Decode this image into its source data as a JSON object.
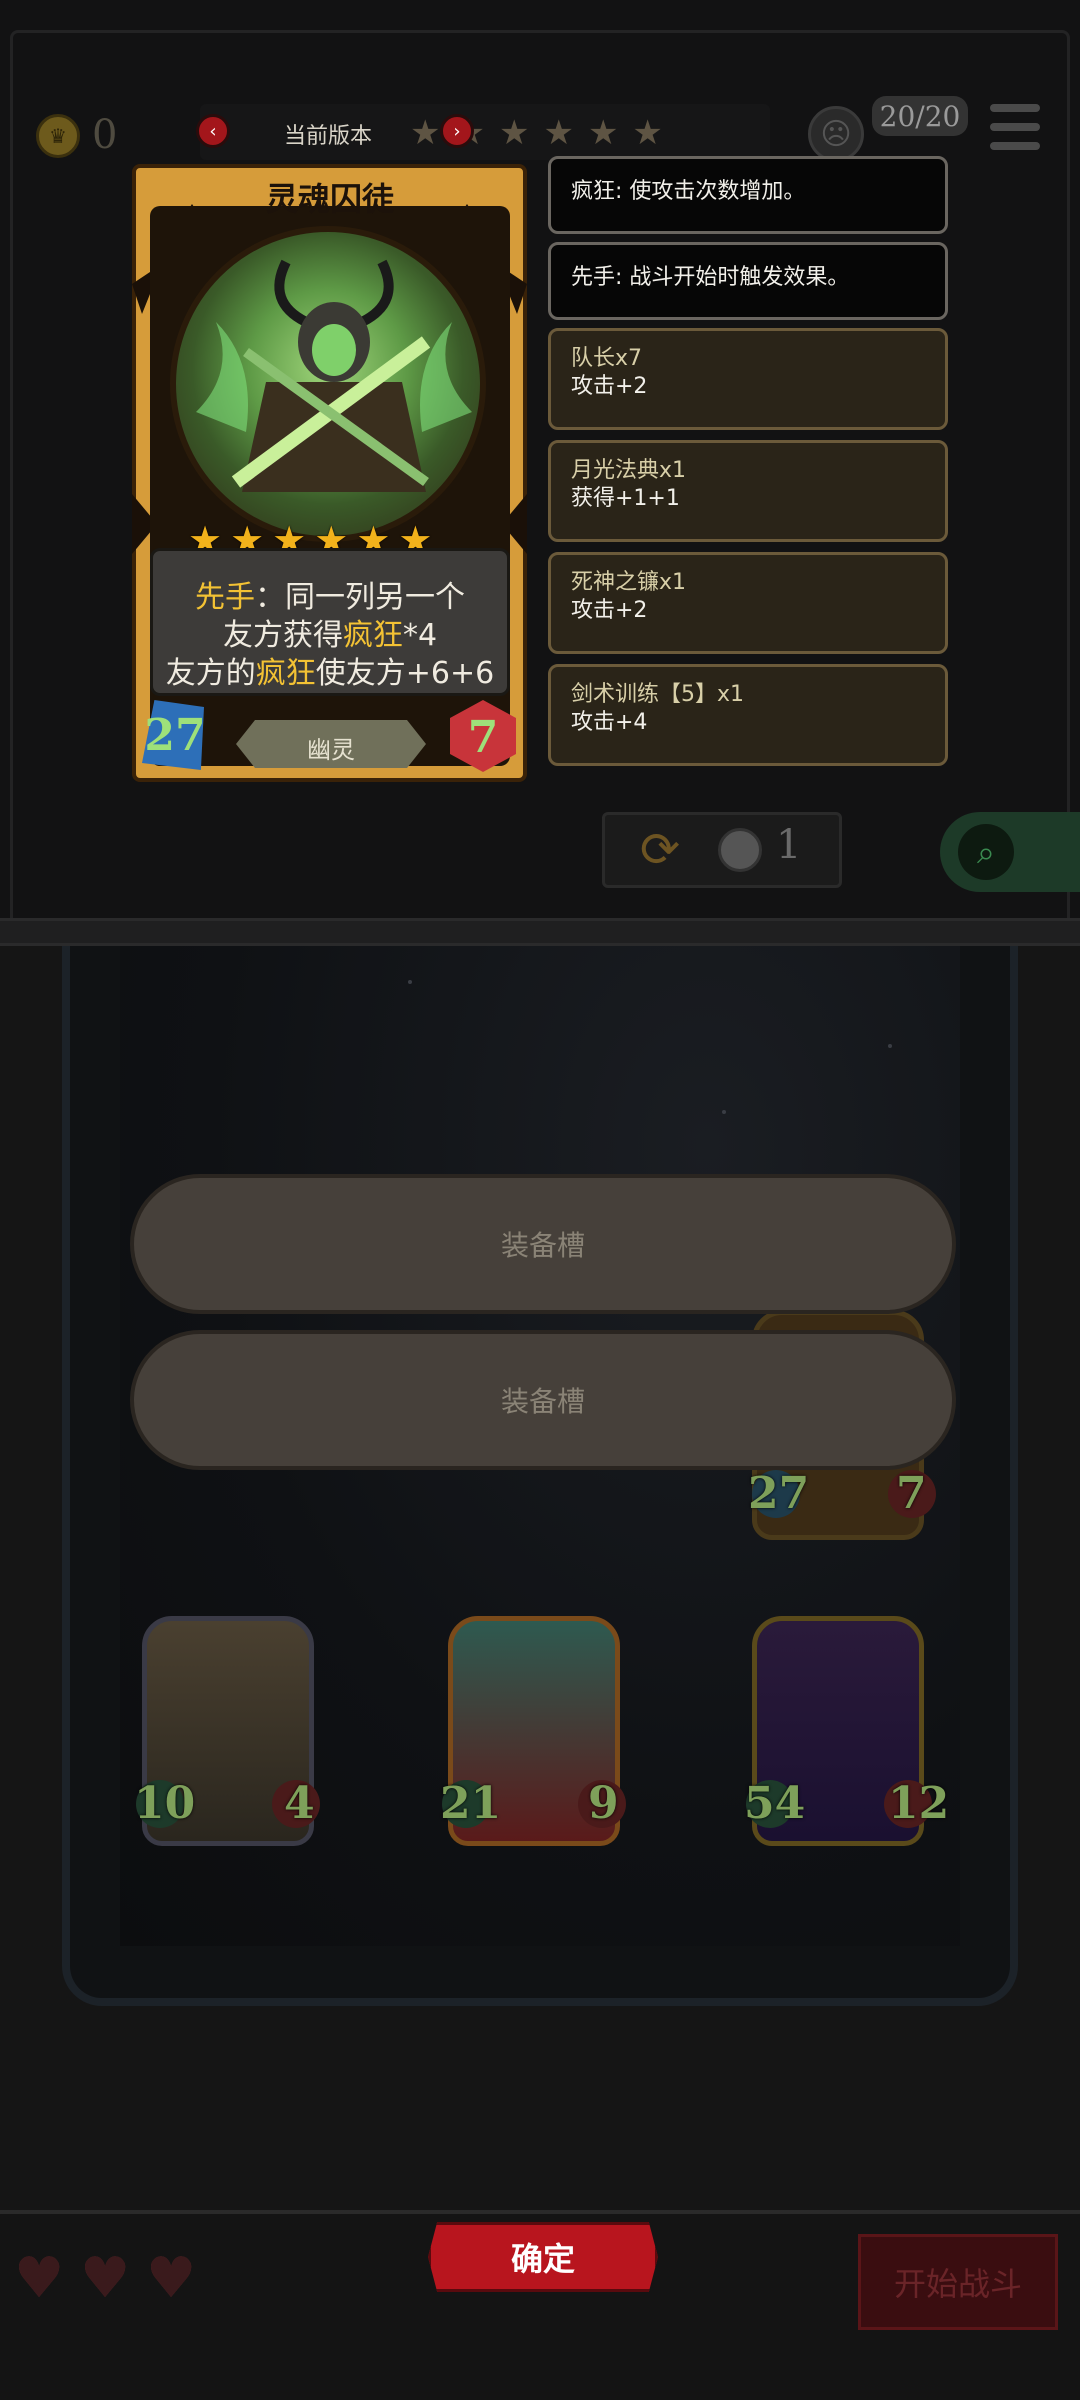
{
  "currency": {
    "count": "0",
    "icon": "crown-coin-icon"
  },
  "version": {
    "label": "当前版本",
    "star_count": 6
  },
  "hand": {
    "count": "20/20"
  },
  "card": {
    "name": "灵魂囚徒",
    "stars": 6,
    "ability": {
      "line1_kw": "先手",
      "line1_rest": "：同一列另一个",
      "line2_pre": "友方获得",
      "line2_kw": "疯狂",
      "line2_post": "*4",
      "line3_pre": "友方的",
      "line3_kw": "疯狂",
      "line3_post": "使友方+6+6"
    },
    "attack": "27",
    "type": "幽灵",
    "health": "7"
  },
  "keywords": [
    {
      "text": "疯狂: 使攻击次数增加。"
    },
    {
      "text": "先手: 战斗开始时触发效果。"
    }
  ],
  "equipment": [
    {
      "name": "队长x7",
      "effect": "攻击+2"
    },
    {
      "name": "月光法典x1",
      "effect": "获得+1+1"
    },
    {
      "name": "死神之镰x1",
      "effect": "攻击+2"
    },
    {
      "name": "剑术训练【5】x1",
      "effect": "攻击+4"
    }
  ],
  "refresh": {
    "token_count": "1"
  },
  "slots": [
    {
      "label": "装备槽"
    },
    {
      "label": "装备槽"
    }
  ],
  "board_cards": [
    {
      "attack": "27",
      "health": "7"
    },
    {
      "attack": "10",
      "health": "4"
    },
    {
      "attack": "21",
      "health": "9"
    },
    {
      "attack": "54",
      "health": "12"
    }
  ],
  "lives": 3,
  "buttons": {
    "confirm": "确定",
    "start_battle": "开始战斗"
  },
  "colors": {
    "highlight": "#f3c234",
    "card_frame": "#d69c3a",
    "confirm": "#b8151e"
  }
}
